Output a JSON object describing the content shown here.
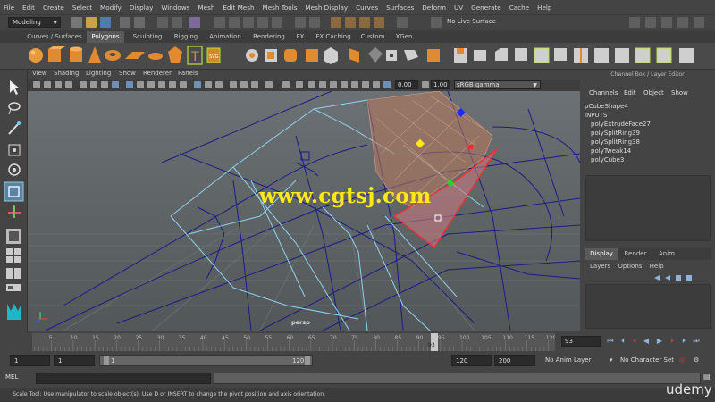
{
  "menubar": [
    "File",
    "Edit",
    "Create",
    "Select",
    "Modify",
    "Display",
    "Windows",
    "Mesh",
    "Edit Mesh",
    "Mesh Tools",
    "Mesh Display",
    "Curves",
    "Surfaces",
    "Deform",
    "UV",
    "Generate",
    "Cache",
    "Help"
  ],
  "status_line": {
    "mode": "Modeling",
    "live_surface": "No Live Surface"
  },
  "shelf_tabs": [
    "Curves / Surfaces",
    "Polygons",
    "Sculpting",
    "Rigging",
    "Animation",
    "Rendering",
    "FX",
    "FX Caching",
    "Custom",
    "XGen"
  ],
  "shelf_active": "Polygons",
  "viewport": {
    "menu": [
      "View",
      "Shading",
      "Lighting",
      "Show",
      "Renderer",
      "Panels"
    ],
    "gamma_low": "0.00",
    "gamma_high": "1.00",
    "color_space": "sRGB gamma",
    "camera": "persp"
  },
  "watermark": "www.cgtsj.com",
  "channel_box": {
    "title": "Channel Box / Layer Editor",
    "menu": [
      "Channels",
      "Edit",
      "Object",
      "Show"
    ],
    "node": "pCubeShape4",
    "inputs_label": "INPUTS",
    "inputs": [
      "polyExtrudeFace27",
      "polySplitRing39",
      "polySplitRing38",
      "polyTweak14",
      "polyCube3"
    ]
  },
  "layer_editor": {
    "tabs": [
      "Display",
      "Render",
      "Anim"
    ],
    "active_tab": "Display",
    "menu": [
      "Layers",
      "Options",
      "Help"
    ]
  },
  "time_slider": {
    "ticks": [
      "5",
      "10",
      "15",
      "20",
      "25",
      "30",
      "35",
      "40",
      "45",
      "50",
      "55",
      "60",
      "65",
      "70",
      "75",
      "80",
      "85",
      "90",
      "95",
      "100",
      "105",
      "110",
      "115",
      "120"
    ],
    "current_marker": "93",
    "current_frame": "93"
  },
  "range_slider": {
    "start": "1",
    "playback_start": "1",
    "range_field": "1",
    "range_bar_start": "1",
    "range_bar_end": "120",
    "playback_end": "120",
    "end": "200",
    "anim_layer": "No Anim Layer",
    "character_set": "No Character Set"
  },
  "command_line": {
    "label": "MEL"
  },
  "help_line": "Scale Tool: Use manipulator to scale object(s). Use D or INSERT to change the pivot position and axis orientation.",
  "brand": "udemy",
  "colors": {
    "accent_blue": "#5a83a8",
    "watermark": "#ffe81a",
    "wire_dark": "#1a1a7a",
    "wire_light": "#8fd3ee"
  }
}
